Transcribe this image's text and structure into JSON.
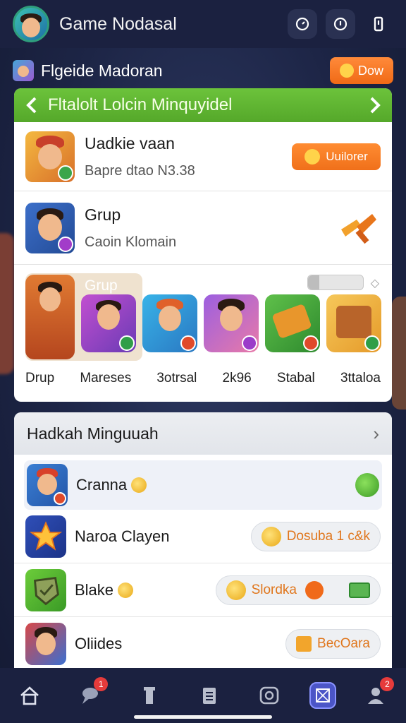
{
  "app": {
    "title": "Game Nodasal"
  },
  "subheader": {
    "label": "Flgeide Madoran",
    "button_label": "Dow"
  },
  "featured": {
    "header_title": "Fltalolt Lolcin Minquyidel",
    "rows": [
      {
        "title": "Uadkie vaan",
        "subtitle": "Bapre  dtao N3.38",
        "button_label": "Uuilorer"
      },
      {
        "title": "Grup",
        "subtitle": "Caoin Klomain"
      }
    ],
    "gallery": {
      "title": "Grup",
      "labels": [
        "Drup",
        "Mareses",
        "3otrsal",
        "2k96",
        "Stabal",
        "3ttaloa"
      ]
    }
  },
  "leaderboard": {
    "title": "Hadkah Minguuah",
    "items": [
      {
        "name": "Cranna"
      },
      {
        "name": "Naroa Clayen",
        "pill_text": "Dosuba 1 c&k"
      },
      {
        "name": "Blake",
        "pill_text": "Slordka"
      },
      {
        "name": "Oliides",
        "pill_text": "BecOara"
      }
    ]
  },
  "nav": {
    "badges": [
      "1",
      "2"
    ]
  },
  "colors": {
    "accent_orange": "#f0701a",
    "header_green": "#5ab02f",
    "nav_active": "#4b55c7",
    "background": "#1d2546"
  }
}
